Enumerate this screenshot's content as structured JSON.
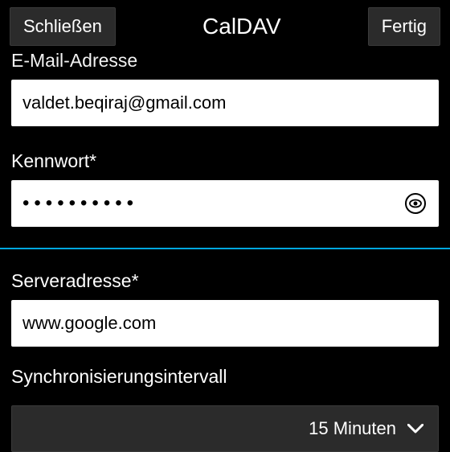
{
  "header": {
    "close_label": "Schließen",
    "title": "CalDAV",
    "done_label": "Fertig"
  },
  "fields": {
    "email_label": "E-Mail-Adresse",
    "email_value": "valdet.beqiraj@gmail.com",
    "password_label": "Kennwort*",
    "password_value": "••••••••••",
    "server_label": "Serveradresse*",
    "server_value": "www.google.com",
    "sync_label": "Synchronisierungsintervall",
    "sync_value": "15 Minuten"
  }
}
